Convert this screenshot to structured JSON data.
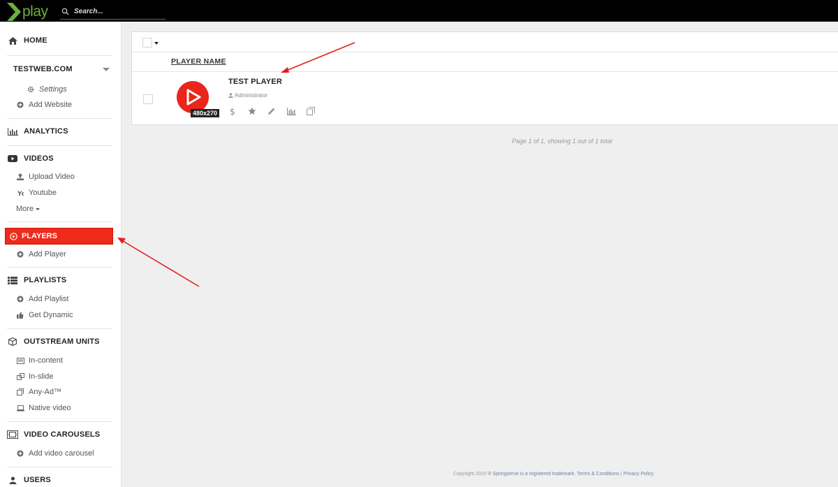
{
  "app": {
    "logo_text": "play",
    "accent_color": "#ee2a1b",
    "logo_color": "#6fae3e"
  },
  "search": {
    "placeholder": "Search..."
  },
  "sidebar": {
    "home": "HOME",
    "website": "TESTWEB.COM",
    "website_settings": "Settings",
    "add_website": "Add Website",
    "analytics": "ANALYTICS",
    "videos": "VIDEOS",
    "upload_video": "Upload Video",
    "youtube": "Youtube",
    "more": "More",
    "players": "PLAYERS",
    "add_player": "Add Player",
    "playlists": "PLAYLISTS",
    "add_playlist": "Add Playlist",
    "get_dynamic": "Get Dynamic",
    "outstream_units": "OUTSTREAM UNITS",
    "in_content": "In-content",
    "in_slide": "In-slide",
    "any_ad": "Any-Ad™",
    "native_video": "Native video",
    "video_carousels": "VIDEO CAROUSELS",
    "add_video_carousel": "Add video carousel",
    "users": "USERS"
  },
  "table": {
    "column_header": "PLAYER NAME",
    "rows": [
      {
        "name": "TEST PLAYER",
        "owner": "Administrator",
        "size": "480x270"
      }
    ]
  },
  "pagination": {
    "text": "Page 1 of 1, showing 1 out of 1 total"
  },
  "footer": {
    "copyright": "Copyright 2020",
    "brand_link": "® Springserve is a registered trademark.",
    "terms_link": "Terms & Conditions",
    "separator": "|",
    "privacy_link": "Privacy Policy"
  }
}
